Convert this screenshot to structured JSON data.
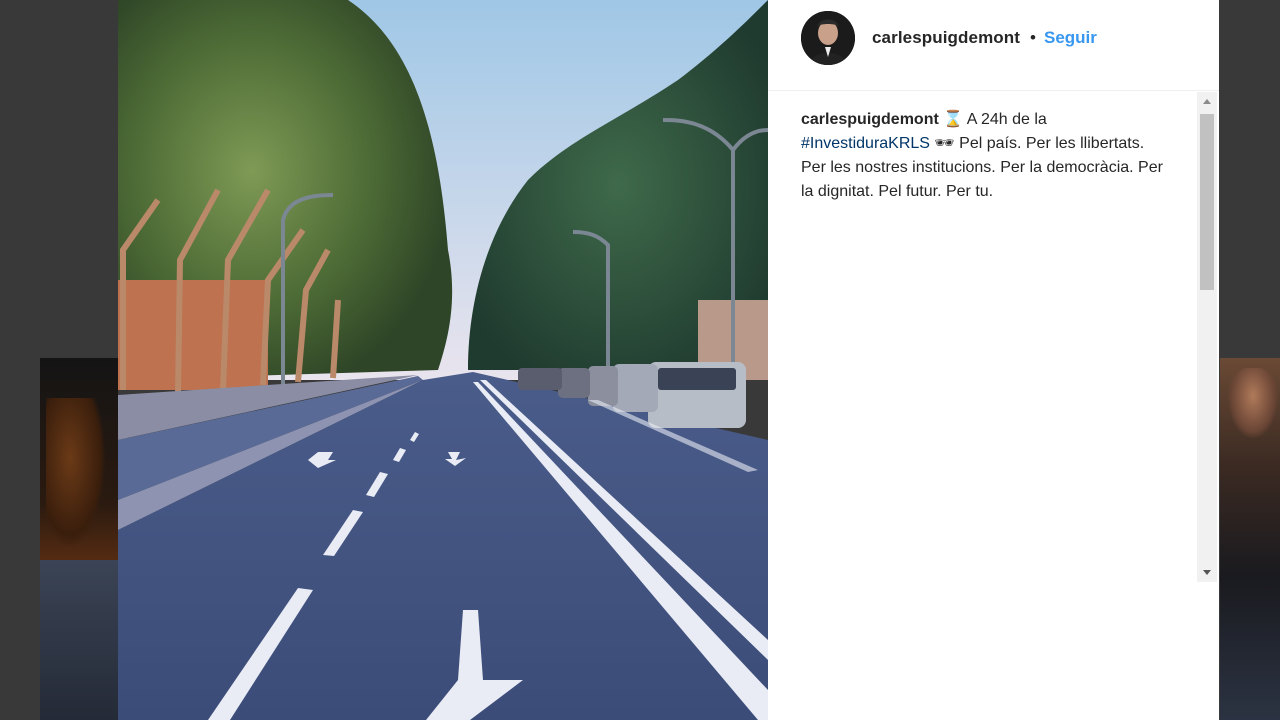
{
  "post": {
    "username": "carlespuigdemont",
    "separator": "•",
    "follow_label": "Seguir"
  },
  "caption": {
    "username": "carlespuigdemont",
    "hourglass_icon": "⌛",
    "text_before_tag": " A 24h de la ",
    "hashtag": "#InvestiduraKRLS",
    "glasses_icon": "🕶",
    "text_after_tag": " Pel país. Per les llibertats. Per les nostres institucions. Per la democràcia. Per la dignitat. Pel futur. Per tu."
  },
  "colors": {
    "follow": "#3897f0",
    "hashtag": "#003569",
    "backdrop": "#393939"
  }
}
